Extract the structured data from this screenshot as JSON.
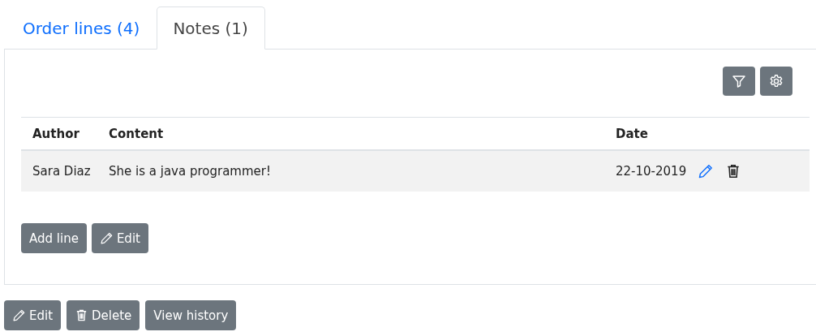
{
  "tabs": [
    {
      "label": "Order lines (4)",
      "selected": false
    },
    {
      "label": "Notes (1)",
      "selected": true
    }
  ],
  "toolbar": [
    {
      "kind": "filter"
    },
    {
      "kind": "settings"
    }
  ],
  "table": {
    "columns": [
      "Author",
      "Content",
      "Date"
    ],
    "rows": [
      {
        "cells": [
          "Sara Diaz",
          "She is a java programmer!",
          "22-10-2019"
        ],
        "actions": [
          {
            "kind": "edit"
          },
          {
            "kind": "delete"
          }
        ]
      }
    ]
  },
  "panel_buttons": [
    {
      "label": "Add line",
      "kind": "plain"
    },
    {
      "label": "Edit",
      "kind": "edit"
    }
  ],
  "footer_buttons": [
    {
      "label": "Edit",
      "kind": "edit"
    },
    {
      "label": "Delete",
      "kind": "delete"
    },
    {
      "label": "View history",
      "kind": "plain"
    }
  ]
}
